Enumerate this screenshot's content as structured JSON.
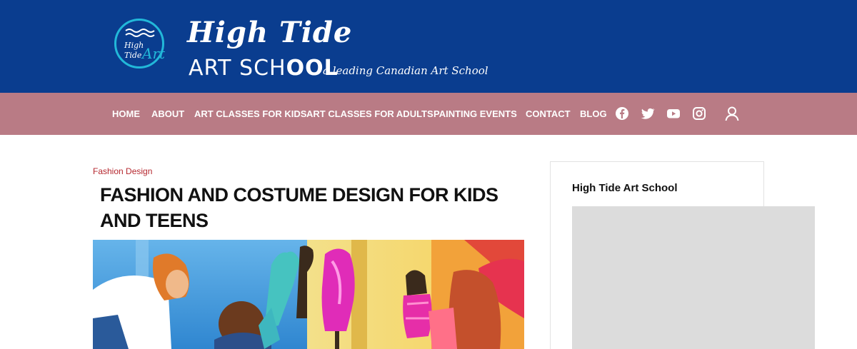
{
  "header": {
    "logo_mark": {
      "line1": "High",
      "line2": "Tide",
      "art": "Art"
    },
    "logo_script": "High Tide",
    "logo_school_prefix": "ART SCH",
    "logo_school_bold": "OOL",
    "tagline": "a leading Canadian Art School",
    "brand_color": "#0a3d8f",
    "accent_color": "#22b8d9"
  },
  "nav": {
    "bg_color": "#b97b85",
    "items": [
      {
        "label": "HOME"
      },
      {
        "label": "ABOUT"
      },
      {
        "label": "ART CLASSES FOR KIDS"
      },
      {
        "label": "ART CLASSES FOR ADULTS"
      },
      {
        "label": "PAINTING EVENTS"
      },
      {
        "label": "CONTACT"
      },
      {
        "label": "BLOG"
      }
    ],
    "social": [
      "facebook-icon",
      "twitter-icon",
      "youtube-icon",
      "instagram-icon"
    ],
    "account_icon": "user-icon"
  },
  "post": {
    "category": "Fashion Design",
    "title": "FASHION AND COSTUME DESIGN FOR KIDS AND TEENS",
    "category_color": "#b5272e"
  },
  "sidebar": {
    "widget_title": "High Tide Art School"
  }
}
